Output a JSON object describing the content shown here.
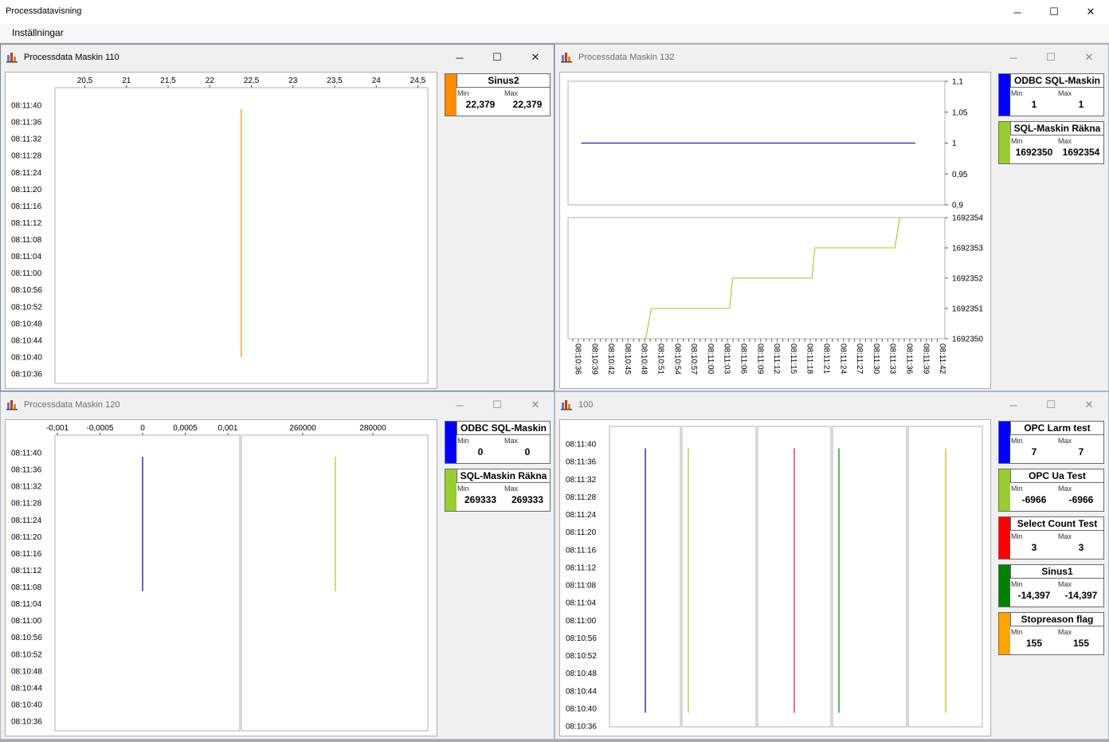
{
  "app": {
    "title": "Processdatavisning",
    "menu": [
      "Inställningar"
    ],
    "controls": {
      "minimize": "─",
      "maximize": "☐",
      "close": "✕"
    }
  },
  "windows": [
    {
      "title": "Processdata Maskin 110",
      "active": true,
      "legends": [
        {
          "name": "Sinus2",
          "color": "#ff8c00",
          "min_label": "Min",
          "max_label": "Max",
          "min": "22,379",
          "max": "22,379"
        }
      ],
      "chart_data": {
        "type": "line",
        "orientation": "vertical-time",
        "x_ticks": [
          "20,5",
          "21",
          "21,5",
          "22",
          "22,5",
          "23",
          "23,5",
          "24",
          "24,5"
        ],
        "x_tick_values": [
          20.5,
          21,
          21.5,
          22,
          22.5,
          23,
          23.5,
          24,
          24.5
        ],
        "time_ticks": [
          "08:11:40",
          "08:11:36",
          "08:11:32",
          "08:11:28",
          "08:11:24",
          "08:11:20",
          "08:11:16",
          "08:11:12",
          "08:11:08",
          "08:11:04",
          "08:11:00",
          "08:10:56",
          "08:10:52",
          "08:10:48",
          "08:10:44",
          "08:10:40",
          "08:10:36"
        ],
        "series": [
          {
            "name": "Sinus2",
            "color": "#ff8c00",
            "value": 22.379,
            "t_start": "08:10:40",
            "t_end": "08:11:39"
          }
        ]
      }
    },
    {
      "title": "Processdata Maskin 132",
      "active": false,
      "legends": [
        {
          "name": "ODBC SQL-Maskin",
          "color": "#0000ff",
          "min_label": "Min",
          "max_label": "Max",
          "min": "1",
          "max": "1"
        },
        {
          "name": "SQL-Maskin Räkna",
          "color": "#9acd32",
          "min_label": "Min",
          "max_label": "Max",
          "min": "1692350",
          "max": "1692354"
        }
      ],
      "chart_data": {
        "type": "line",
        "time_ticks": [
          "08:10:36",
          "08:10:39",
          "08:10:42",
          "08:10:45",
          "08:10:48",
          "08:10:51",
          "08:10:54",
          "08:10:57",
          "08:11:00",
          "08:11:03",
          "08:11:06",
          "08:11:09",
          "08:11:12",
          "08:11:15",
          "08:11:18",
          "08:11:21",
          "08:11:24",
          "08:11:27",
          "08:11:30",
          "08:11:33",
          "08:11:36",
          "08:11:39",
          "08:11:42"
        ],
        "panels": [
          {
            "y_ticks": [
              "1,1",
              "1,05",
              "1",
              "0,95",
              "0,9"
            ],
            "y_tick_values": [
              1.1,
              1.05,
              1,
              0.95,
              0.9
            ],
            "series": [
              {
                "name": "ODBC SQL-Maskin",
                "color": "#000080",
                "t": [
                  1.5,
                  62
                ],
                "y": [
                  1,
                  1
                ]
              }
            ]
          },
          {
            "y_ticks": [
              "1692354",
              "1692353",
              "1692352",
              "1692351",
              "1692350"
            ],
            "y_tick_values": [
              1692354,
              1692353,
              1692352,
              1692351,
              1692350
            ],
            "series": [
              {
                "name": "SQL-Maskin Räkna",
                "color": "#9acd32",
                "t": [
                  13.2,
                  14.2,
                  14.2,
                  28.4,
                  28.9,
                  28.9,
                  43.3,
                  43.8,
                  43.8,
                  58.3,
                  59.2
                ],
                "y": [
                  1692350,
                  1692351,
                  1692351,
                  1692351,
                  1692352,
                  1692352,
                  1692352,
                  1692353,
                  1692353,
                  1692353,
                  1692354
                ]
              }
            ]
          }
        ]
      }
    },
    {
      "title": "Processdata Maskin 120",
      "active": false,
      "legends": [
        {
          "name": "ODBC SQL-Maskin",
          "color": "#0000ff",
          "min_label": "Min",
          "max_label": "Max",
          "min": "0",
          "max": "0"
        },
        {
          "name": "SQL-Maskin Räkna",
          "color": "#9acd32",
          "min_label": "Min",
          "max_label": "Max",
          "min": "269333",
          "max": "269333"
        }
      ],
      "chart_data": {
        "type": "line",
        "orientation": "vertical-time",
        "time_ticks": [
          "08:11:40",
          "08:11:36",
          "08:11:32",
          "08:11:28",
          "08:11:24",
          "08:11:20",
          "08:11:16",
          "08:11:12",
          "08:11:08",
          "08:11:04",
          "08:11:00",
          "08:10:56",
          "08:10:52",
          "08:10:48",
          "08:10:44",
          "08:10:40",
          "08:10:36"
        ],
        "panels": [
          {
            "x_ticks": [
              "-0,001",
              "-0,0005",
              "0",
              "0,0005",
              "0,001"
            ],
            "x_tick_values": [
              -0.001,
              -0.0005,
              0,
              0.0005,
              0.001
            ],
            "series": [
              {
                "name": "ODBC SQL-Maskin",
                "color": "#000080",
                "value": 0,
                "t_start": "08:11:07",
                "t_end": "08:11:39"
              }
            ]
          },
          {
            "x_ticks": [
              "260000",
              "280000"
            ],
            "x_tick_values": [
              260000,
              280000
            ],
            "series": [
              {
                "name": "SQL-Maskin Räkna",
                "color": "#9acd32",
                "value": 269333,
                "t_start": "08:11:07",
                "t_end": "08:11:39"
              }
            ]
          }
        ]
      }
    },
    {
      "title": "100",
      "active": false,
      "legends": [
        {
          "name": "OPC Larm test",
          "color": "#0000ff",
          "min_label": "Min",
          "max_label": "Max",
          "min": "7",
          "max": "7"
        },
        {
          "name": "OPC Ua Test",
          "color": "#9acd32",
          "min_label": "Min",
          "max_label": "Max",
          "min": "-6966",
          "max": "-6966"
        },
        {
          "name": "Select Count Test",
          "color": "#ff0000",
          "min_label": "Min",
          "max_label": "Max",
          "min": "3",
          "max": "3"
        },
        {
          "name": "Sinus1",
          "color": "#008000",
          "min_label": "Min",
          "max_label": "Max",
          "min": "-14,397",
          "max": "-14,397"
        },
        {
          "name": "Stopreason flag",
          "color": "#ffa500",
          "min_label": "Min",
          "max_label": "Max",
          "min": "155",
          "max": "155"
        }
      ],
      "chart_data": {
        "type": "line",
        "orientation": "vertical-time",
        "time_ticks": [
          "08:11:40",
          "08:11:36",
          "08:11:32",
          "08:11:28",
          "08:11:24",
          "08:11:20",
          "08:11:16",
          "08:11:12",
          "08:11:08",
          "08:11:04",
          "08:11:00",
          "08:10:56",
          "08:10:52",
          "08:10:48",
          "08:10:44",
          "08:10:40",
          "08:10:36"
        ],
        "panels": [
          {
            "series": [
              {
                "name": "OPC Larm test",
                "color": "#000080",
                "t_start": "08:10:39",
                "t_end": "08:11:39"
              }
            ]
          },
          {
            "series": [
              {
                "name": "OPC Ua Test",
                "color": "#9acd32",
                "t_start": "08:10:39",
                "t_end": "08:11:39"
              }
            ]
          },
          {
            "series": [
              {
                "name": "Select Count Test",
                "color": "#dc143c",
                "t_start": "08:10:39",
                "t_end": "08:11:39"
              }
            ]
          },
          {
            "series": [
              {
                "name": "Sinus1",
                "color": "#008000",
                "t_start": "08:10:39",
                "t_end": "08:11:39"
              }
            ]
          },
          {
            "series": [
              {
                "name": "Stopreason flag",
                "color": "#c8b400",
                "t_start": "08:10:39",
                "t_end": "08:11:39"
              }
            ]
          }
        ]
      }
    }
  ]
}
